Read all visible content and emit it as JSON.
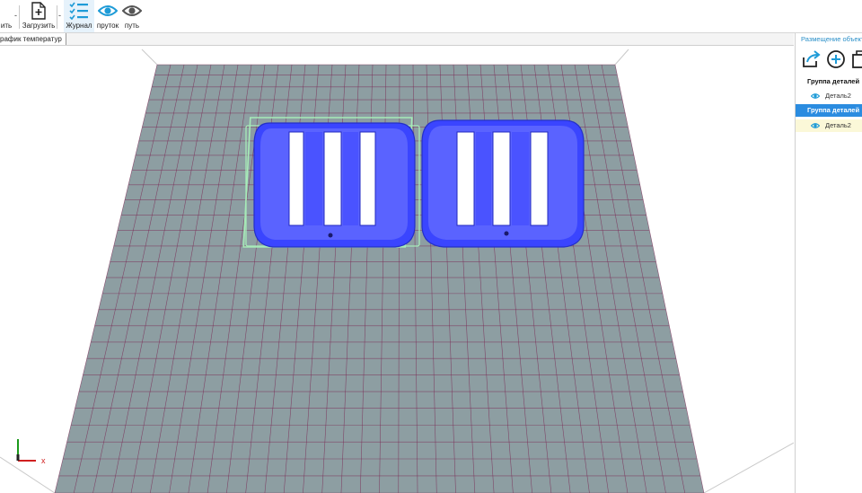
{
  "toolbar": {
    "partial_left_label": "ить",
    "load_label": "Загрузить",
    "journal_label": "Журнал",
    "filament_label": "пруток",
    "path_label": "путь",
    "accent_color": "#1e9bd7"
  },
  "tabs": {
    "temperature_tab": "рафик температур"
  },
  "viewport": {
    "bed_color": "#8d9ea2",
    "grid_line_color": "#7a2a55",
    "part_color": "#3a45ff",
    "selection_color": "#9fe8b0",
    "axis_x_label": "x"
  },
  "right_panel": {
    "title": "Размещение объекта",
    "groups": [
      {
        "label": "Группа деталей",
        "selected": false,
        "parts": [
          "Деталь2"
        ]
      },
      {
        "label": "Группа деталей",
        "selected": true,
        "parts": [
          "Деталь2"
        ]
      }
    ],
    "icons": [
      "export-icon",
      "add-circle-icon",
      "copy-icon"
    ]
  }
}
